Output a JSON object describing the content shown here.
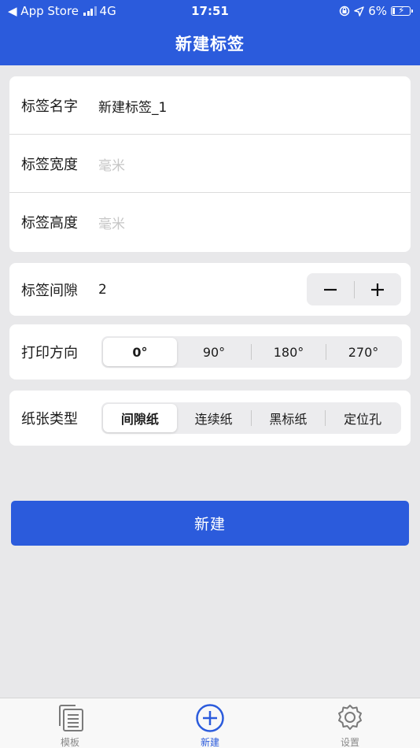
{
  "status_bar": {
    "carrier_back": "◀ App Store",
    "network": "4G",
    "time": "17:51",
    "battery": "6%"
  },
  "nav": {
    "title": "新建标签"
  },
  "fields": {
    "name": {
      "label": "标签名字",
      "value": "新建标签_1"
    },
    "width": {
      "label": "标签宽度",
      "placeholder": "毫米"
    },
    "height": {
      "label": "标签高度",
      "placeholder": "毫米"
    }
  },
  "gap": {
    "label": "标签间隙",
    "value": "2",
    "minus": "−",
    "plus": "+"
  },
  "direction": {
    "label": "打印方向",
    "options": [
      "0°",
      "90°",
      "180°",
      "270°"
    ],
    "selected_index": 0
  },
  "paper": {
    "label": "纸张类型",
    "options": [
      "间隙纸",
      "连续纸",
      "黑标纸",
      "定位孔"
    ],
    "selected_index": 0
  },
  "create_button": "新建",
  "tabbar": {
    "items": [
      {
        "label": "模板",
        "icon": "template-icon"
      },
      {
        "label": "新建",
        "icon": "add-circle-icon"
      },
      {
        "label": "设置",
        "icon": "gear-icon"
      }
    ],
    "active_index": 1
  },
  "colors": {
    "accent": "#2b5bdc",
    "background": "#e8e8ea",
    "placeholder": "#c6c6c6"
  }
}
